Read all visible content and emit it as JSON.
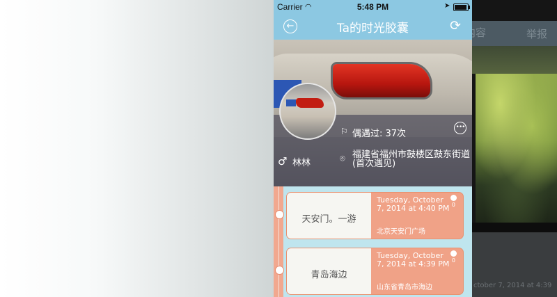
{
  "statusbar": {
    "carrier": "Carrier",
    "time": "5:48 PM"
  },
  "nav": {
    "title": "Ta的时光胶囊",
    "back_icon": "back-circle-icon",
    "refresh_icon": "refresh-icon"
  },
  "profile": {
    "meet_count": "偶遇过: 37次",
    "name": "林林",
    "location": "福建省福州市鼓楼区鼓东街道(首次遇见)"
  },
  "timeline": {
    "items": [
      {
        "title": "天安门。一游",
        "date": "Tuesday, October 7, 2014 at 4:40 PM",
        "place": "北京天安门广场",
        "count": "0"
      },
      {
        "title": "青岛海边",
        "date": "Tuesday, October 7, 2014 at 4:39 PM",
        "place": "山东省青岛市海边",
        "count": "0"
      }
    ]
  },
  "background_page": {
    "content_label": "内容",
    "report_label": "举报",
    "date_fragment": "ctober 7, 2014 at 4:39"
  },
  "colors": {
    "nav_blue": "#8cc8e2",
    "card_orange": "#f0a287",
    "timeline_bg": "#bfe5ee"
  }
}
